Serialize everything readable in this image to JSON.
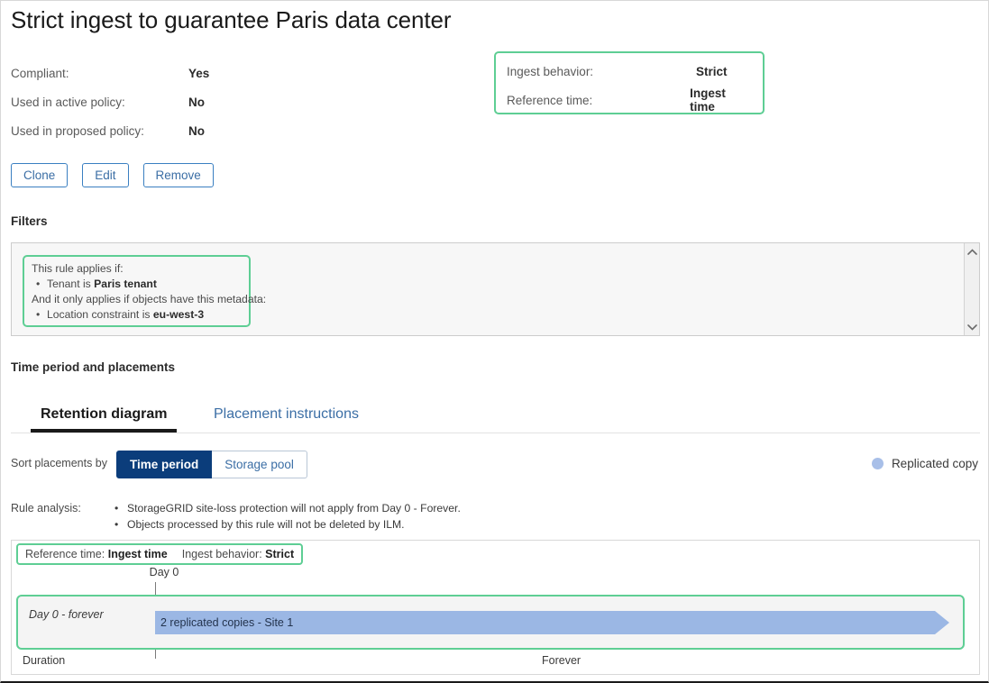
{
  "page": {
    "title": "Strict ingest to guarantee Paris data center"
  },
  "meta": {
    "rows": [
      {
        "label": "Compliant:",
        "value": "Yes"
      },
      {
        "label": "Used in active policy:",
        "value": "No"
      },
      {
        "label": "Used in proposed policy:",
        "value": "No"
      }
    ]
  },
  "behavior_box": {
    "rows": [
      {
        "label": "Ingest behavior:",
        "value": "Strict"
      },
      {
        "label": "Reference time:",
        "value": "Ingest time"
      }
    ]
  },
  "buttons": {
    "clone": "Clone",
    "edit": "Edit",
    "remove": "Remove"
  },
  "filters": {
    "heading": "Filters",
    "applies_if": "This rule applies if:",
    "applies_bullet_prefix": "Tenant is ",
    "applies_bullet_value": "Paris tenant",
    "metadata_intro": "And it only applies if objects have this metadata:",
    "metadata_bullet_prefix": "Location constraint is ",
    "metadata_bullet_value": "eu-west-3",
    "scroll_up_icon": "chevron-up-icon",
    "scroll_down_icon": "chevron-down-icon"
  },
  "time_period": {
    "heading": "Time period and placements",
    "tabs": [
      {
        "label": "Retention diagram",
        "active": true
      },
      {
        "label": "Placement instructions",
        "active": false
      }
    ],
    "sort_label": "Sort placements by",
    "sort_options": [
      {
        "label": "Time period",
        "selected": true
      },
      {
        "label": "Storage pool",
        "selected": false
      }
    ],
    "legend": {
      "icon": "filled-circle-icon",
      "color": "#a8bfe8",
      "label": "Replicated copy"
    },
    "rule_analysis_label": "Rule analysis:",
    "rule_analysis_items": [
      "StorageGRID site-loss protection will not apply from Day 0 - Forever.",
      "Objects processed by this rule will not be deleted by ILM."
    ]
  },
  "chart_data": {
    "type": "bar",
    "title": "Retention diagram",
    "reference_time_label": "Reference time:",
    "reference_time_value": "Ingest time",
    "ingest_behavior_label": "Ingest behavior:",
    "ingest_behavior_value": "Strict",
    "start_tick_label": "Day 0",
    "xlabel": "Duration",
    "end_label": "Forever",
    "categories": [
      "Day 0 - forever"
    ],
    "series": [
      {
        "name": "Replicated copy",
        "label": "2 replicated copies - Site 1",
        "color": "#9bb7e4",
        "start": "Day 0",
        "end": "Forever",
        "copies": 2,
        "site": "Site 1",
        "open_ended": true
      }
    ],
    "legend": [
      "Replicated copy"
    ],
    "grid": false
  }
}
